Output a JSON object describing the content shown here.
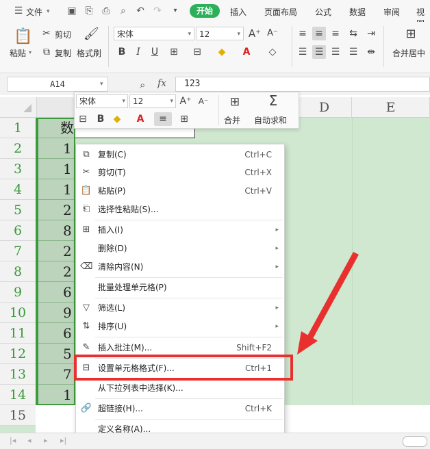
{
  "menubar": {
    "file": "文件",
    "tabs": [
      "开始",
      "插入",
      "页面布局",
      "公式",
      "数据",
      "审阅",
      "视图"
    ]
  },
  "ribbon": {
    "paste": "粘贴",
    "cut": "剪切",
    "copy": "复制",
    "format_painter": "格式刷",
    "font_name": "宋体",
    "font_size": "12",
    "merge_center": "合并居中"
  },
  "formula_bar": {
    "cell_ref": "A14",
    "fx": "fx",
    "value": "123"
  },
  "columns": [
    "D",
    "E"
  ],
  "rows": [
    "1",
    "2",
    "3",
    "4",
    "5",
    "6",
    "7",
    "8",
    "9",
    "10",
    "11",
    "12",
    "13",
    "14",
    "15"
  ],
  "cells_a": [
    "数据",
    "1",
    "1",
    "1",
    "2",
    "8",
    "2",
    "2",
    "6",
    "9",
    "6",
    "5",
    "7",
    "1"
  ],
  "mini_toolbar": {
    "font_name": "宋体",
    "font_size": "12",
    "merge": "合并",
    "autosum": "自动求和"
  },
  "context_menu": [
    {
      "label": "复制(C)",
      "shortcut": "Ctrl+C"
    },
    {
      "label": "剪切(T)",
      "shortcut": "Ctrl+X"
    },
    {
      "label": "粘贴(P)",
      "shortcut": "Ctrl+V"
    },
    {
      "label": "选择性粘贴(S)...",
      "shortcut": ""
    },
    {
      "label": "插入(I)",
      "shortcut": ""
    },
    {
      "label": "删除(D)",
      "shortcut": ""
    },
    {
      "label": "清除内容(N)",
      "shortcut": ""
    },
    {
      "label": "批量处理单元格(P)",
      "shortcut": ""
    },
    {
      "label": "筛选(L)",
      "shortcut": ""
    },
    {
      "label": "排序(U)",
      "shortcut": ""
    },
    {
      "label": "插入批注(M)...",
      "shortcut": "Shift+F2"
    },
    {
      "label": "设置单元格格式(F)...",
      "shortcut": "Ctrl+1"
    },
    {
      "label": "从下拉列表中选择(K)...",
      "shortcut": ""
    },
    {
      "label": "超链接(H)...",
      "shortcut": "Ctrl+K"
    },
    {
      "label": "定义名称(A)...",
      "shortcut": ""
    }
  ],
  "colors": {
    "accent": "#2eb05a",
    "annotation": "#e8302f",
    "selection": "#cfe8cf"
  }
}
